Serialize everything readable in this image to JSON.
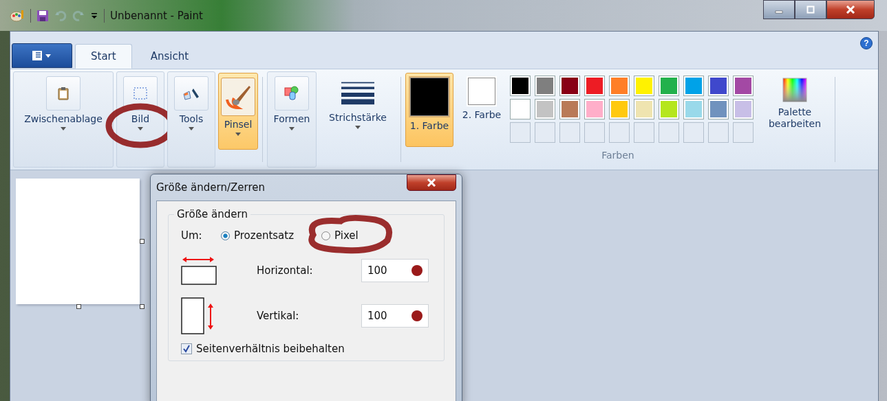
{
  "window": {
    "title": "Unbenannt - Paint"
  },
  "help": {
    "label": "?"
  },
  "tabs": [
    {
      "label": "Start",
      "selected": true
    },
    {
      "label": "Ansicht",
      "selected": false
    }
  ],
  "ribbon_groups": [
    {
      "kind": "clipboard",
      "label": "Zwischenablage",
      "selected": false,
      "circled": false
    },
    {
      "kind": "image",
      "label": "Bild",
      "selected": false,
      "circled": true
    },
    {
      "kind": "tools",
      "label": "Tools",
      "selected": false,
      "circled": false
    },
    {
      "kind": "brush",
      "label": "Pinsel",
      "selected": true,
      "circled": false
    },
    {
      "kind": "shapes",
      "label": "Formen",
      "selected": false,
      "circled": false
    },
    {
      "kind": "stroke",
      "label": "Strichstärke",
      "selected": false,
      "circled": false
    }
  ],
  "colors": {
    "group_label": "Farben",
    "slots": [
      {
        "label": "1. Farbe",
        "color": "#000000",
        "selected": true
      },
      {
        "label": "2. Farbe",
        "color": "#ffffff",
        "selected": false
      }
    ],
    "palette": [
      {
        "kind": "color",
        "color": "#000000"
      },
      {
        "kind": "color",
        "color": "#7f7f7f"
      },
      {
        "kind": "color",
        "color": "#880015"
      },
      {
        "kind": "color",
        "color": "#ed1c24"
      },
      {
        "kind": "color",
        "color": "#ff7f27"
      },
      {
        "kind": "color",
        "color": "#fff200"
      },
      {
        "kind": "color",
        "color": "#22b14c"
      },
      {
        "kind": "color",
        "color": "#00a2e8"
      },
      {
        "kind": "color",
        "color": "#3f48cc"
      },
      {
        "kind": "color",
        "color": "#a349a4"
      },
      {
        "kind": "color",
        "color": "#ffffff"
      },
      {
        "kind": "color",
        "color": "#c3c3c3"
      },
      {
        "kind": "color",
        "color": "#b97a57"
      },
      {
        "kind": "color",
        "color": "#ffaec9"
      },
      {
        "kind": "color",
        "color": "#ffc90e"
      },
      {
        "kind": "color",
        "color": "#efe4b0"
      },
      {
        "kind": "color",
        "color": "#b5e61d"
      },
      {
        "kind": "color",
        "color": "#99d9ea"
      },
      {
        "kind": "color",
        "color": "#7092be"
      },
      {
        "kind": "color",
        "color": "#c8bfe7"
      },
      {
        "kind": "empty"
      },
      {
        "kind": "empty"
      },
      {
        "kind": "empty"
      },
      {
        "kind": "empty"
      },
      {
        "kind": "empty"
      },
      {
        "kind": "empty"
      },
      {
        "kind": "empty"
      },
      {
        "kind": "empty"
      },
      {
        "kind": "empty"
      },
      {
        "kind": "empty"
      }
    ],
    "edit_label": "Palette bearbeiten"
  },
  "dialog": {
    "title": "Größe ändern/Zerren",
    "group_label": "Größe ändern",
    "by_label": "Um:",
    "radios": [
      {
        "label": "Prozentsatz",
        "selected": true,
        "circled": false
      },
      {
        "label": "Pixel",
        "selected": false,
        "circled": true
      }
    ],
    "fields": [
      {
        "kind": "horizontal",
        "label": "Horizontal:",
        "value": "100",
        "marked": true
      },
      {
        "kind": "vertical",
        "label": "Vertikal:",
        "value": "100",
        "marked": true
      }
    ],
    "checkbox": {
      "label": "Seitenverhältnis beibehalten",
      "checked": true
    }
  }
}
